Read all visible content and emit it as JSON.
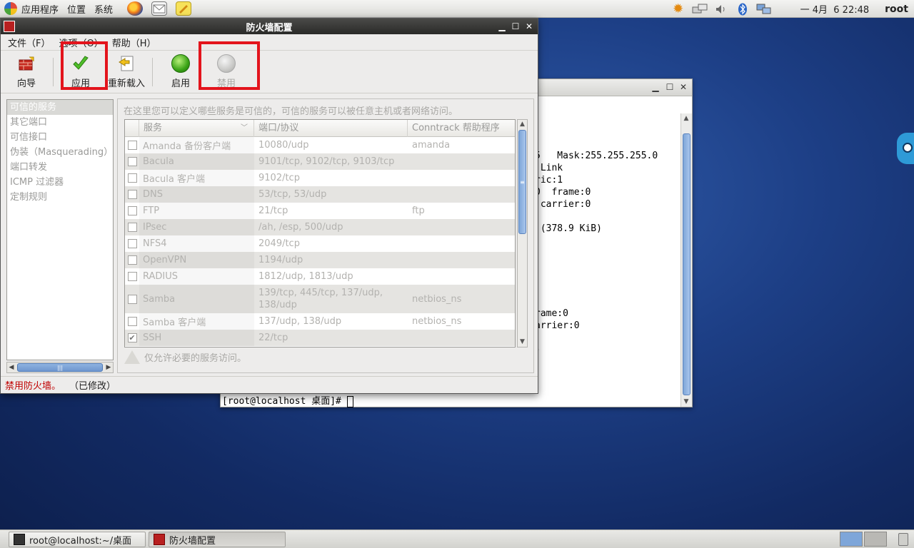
{
  "top_panel": {
    "menus": [
      "应用程序",
      "位置",
      "系统"
    ],
    "clock": "一 4月  6 22:48",
    "user": "root",
    "launchers": [
      "firefox-icon",
      "mail-icon",
      "notes-icon"
    ],
    "tray": [
      "update-icon",
      "network-icon",
      "volume-icon",
      "bluetooth-icon",
      "display-icon"
    ]
  },
  "terminal": {
    "lines": [
      "5   Mask:255.255.255.0",
      " Link",
      "ric:1",
      "0  frame:0",
      " carrier:0",
      " (378.9 KiB)",
      "rame:0",
      "arrier:0",
      ")"
    ],
    "prompt": "[root@localhost 桌面]# "
  },
  "firewall": {
    "title": "防火墙配置",
    "menus": [
      "文件（F）",
      "选项（O）",
      "帮助（H）"
    ],
    "toolbar": {
      "wizard": "向导",
      "apply": "应用",
      "reload": "重新载入",
      "enable": "启用",
      "disable": "禁用"
    },
    "nav": [
      "可信的服务",
      "其它端口",
      "可信接口",
      "伪装（Masquerading）",
      "端口转发",
      "ICMP 过滤器",
      "定制规则"
    ],
    "hint": "在这里您可以定义哪些服务是可信的，可信的服务可以被任意主机或者网络访问。",
    "columns": [
      "服务",
      "端口/协议",
      "Conntrack 帮助程序"
    ],
    "services": [
      {
        "name": "Amanda 备份客户端",
        "port": "10080/udp",
        "helper": "amanda",
        "checked": false
      },
      {
        "name": "Bacula",
        "port": "9101/tcp, 9102/tcp, 9103/tcp",
        "helper": "",
        "checked": false
      },
      {
        "name": "Bacula 客户端",
        "port": "9102/tcp",
        "helper": "",
        "checked": false
      },
      {
        "name": "DNS",
        "port": "53/tcp, 53/udp",
        "helper": "",
        "checked": false
      },
      {
        "name": "FTP",
        "port": "21/tcp",
        "helper": "ftp",
        "checked": false
      },
      {
        "name": "IPsec",
        "port": "/ah, /esp, 500/udp",
        "helper": "",
        "checked": false
      },
      {
        "name": "NFS4",
        "port": "2049/tcp",
        "helper": "",
        "checked": false
      },
      {
        "name": "OpenVPN",
        "port": "1194/udp",
        "helper": "",
        "checked": false
      },
      {
        "name": "RADIUS",
        "port": "1812/udp, 1813/udp",
        "helper": "",
        "checked": false
      },
      {
        "name": "Samba",
        "port": "139/tcp, 445/tcp, 137/udp, 138/udp",
        "helper": "netbios_ns",
        "checked": false
      },
      {
        "name": "Samba 客户端",
        "port": "137/udp, 138/udp",
        "helper": "netbios_ns",
        "checked": false
      },
      {
        "name": "SSH",
        "port": "22/tcp",
        "helper": "",
        "checked": true
      }
    ],
    "note": "仅允许必要的服务访问。",
    "status_main": "禁用防火墙。",
    "status_extra": "（已修改）",
    "status_color": "#c00000"
  },
  "taskbar": {
    "tasks": [
      "root@localhost:~/桌面",
      "防火墙配置"
    ]
  }
}
